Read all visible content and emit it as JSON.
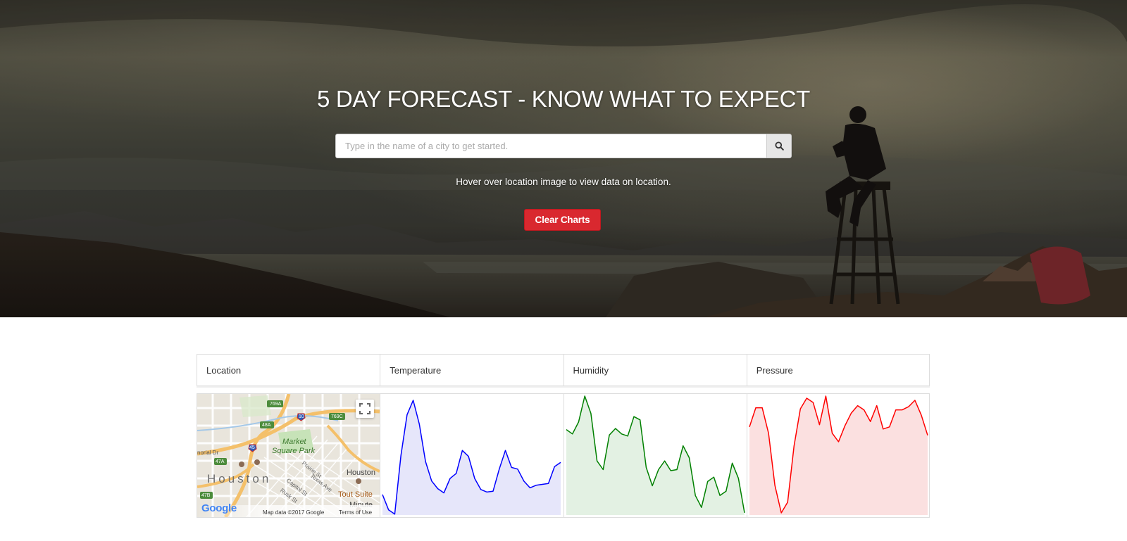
{
  "hero": {
    "title": "5 DAY FORECAST - KNOW WHAT TO EXPECT",
    "search_placeholder": "Type in the name of a city to get started.",
    "search_icon": "search-icon",
    "hint": "Hover over location image to view data on location.",
    "clear_label": "Clear Charts",
    "accent": "#d9282f"
  },
  "table": {
    "headers": [
      "Location",
      "Temperature",
      "Humidity",
      "Pressure"
    ]
  },
  "map": {
    "labels": {
      "market": "Market",
      "square_park": "Square Park",
      "houston": "Houston",
      "houston_right": "Houston",
      "tout_suite": "Tout Suite",
      "minute": "Minute",
      "memorial": "norial Dr",
      "prairie": "Prairie St",
      "texas": "Texas Ave",
      "capitol": "Capitol St",
      "rusk": "Rusk St",
      "i769a": "769A",
      "i769c": "769C",
      "i48a": "48A",
      "i47a": "47A",
      "i47b": "47B",
      "i10": "10",
      "i45": "45"
    },
    "logo": "Google",
    "attribution": "Map data ©2017 Google",
    "terms": "Terms of Use",
    "fullscreen_icon": "fullscreen-icon"
  },
  "chart_data": [
    {
      "type": "area",
      "name": "temperature",
      "color": "#0000ff",
      "fill": "#e6e6fa",
      "values": [
        24,
        6,
        1,
        70,
        118,
        135,
        107,
        63,
        40,
        31,
        26,
        43,
        49,
        76,
        69,
        43,
        30,
        27,
        28,
        54,
        76,
        56,
        54,
        40,
        32,
        35,
        36,
        37,
        57,
        62
      ],
      "ylim": [
        0,
        140
      ]
    },
    {
      "type": "area",
      "name": "humidity",
      "color": "#008000",
      "fill": "#e3f1e3",
      "values": [
        79,
        75,
        86,
        110,
        94,
        50,
        42,
        74,
        80,
        75,
        73,
        91,
        88,
        44,
        27,
        42,
        50,
        41,
        42,
        64,
        53,
        18,
        7,
        31,
        35,
        18,
        22,
        48,
        34,
        2
      ],
      "ylim": [
        0,
        110
      ]
    },
    {
      "type": "area",
      "name": "pressure",
      "color": "#ff0000",
      "fill": "#fbe0e0",
      "values": [
        83,
        101,
        101,
        77,
        28,
        2,
        12,
        65,
        100,
        110,
        106,
        85,
        112,
        77,
        69,
        84,
        96,
        103,
        99,
        88,
        103,
        81,
        83,
        99,
        99,
        102,
        108,
        94,
        75
      ],
      "ylim": [
        0,
        112
      ]
    }
  ]
}
